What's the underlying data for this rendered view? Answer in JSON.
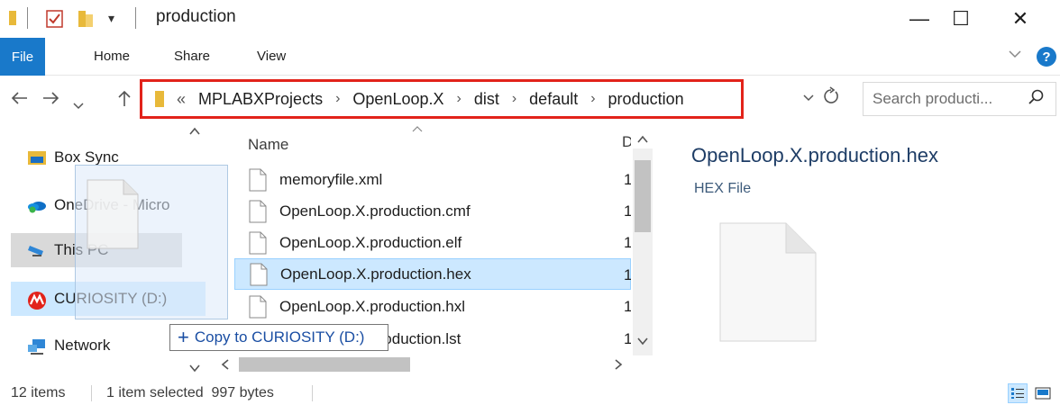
{
  "window": {
    "title": "production",
    "minimize": "—",
    "maximize": "☐",
    "close": "✕"
  },
  "ribbon": {
    "file": "File",
    "tabs": [
      "Home",
      "Share",
      "View"
    ],
    "help": "?"
  },
  "address": {
    "overflow": "«",
    "crumbs": [
      "MPLABXProjects",
      "OpenLoop.X",
      "dist",
      "default",
      "production"
    ]
  },
  "search": {
    "placeholder": "Search producti..."
  },
  "nav_pane": {
    "items": [
      {
        "label": "Box Sync",
        "icon": "box-sync-icon"
      },
      {
        "label": "OneDrive - Micro",
        "icon": "onedrive-icon"
      },
      {
        "label": "This PC",
        "icon": "this-pc-icon"
      },
      {
        "label": "CURIOSITY (D:)",
        "icon": "drive-icon"
      },
      {
        "label": "Network",
        "icon": "network-icon"
      }
    ]
  },
  "file_list": {
    "column_name": "Name",
    "column_date_clip": "D",
    "files": [
      {
        "name": "memoryfile.xml",
        "date_clip": "1"
      },
      {
        "name": "OpenLoop.X.production.cmf",
        "date_clip": "1"
      },
      {
        "name": "OpenLoop.X.production.elf",
        "date_clip": "1"
      },
      {
        "name": "OpenLoop.X.production.hex",
        "date_clip": "1",
        "selected": true
      },
      {
        "name": "OpenLoop.X.production.hxl",
        "date_clip": "1"
      },
      {
        "name": "OpenLoop.X.production.lst",
        "date_clip": "1"
      }
    ]
  },
  "drag_tooltip": {
    "plus": "+",
    "text": "Copy to CURIOSITY (D:)"
  },
  "preview": {
    "filename": "OpenLoop.X.production.hex",
    "filetype": "HEX File"
  },
  "status": {
    "item_count": "12 items",
    "selection": "1 item selected  997 bytes"
  },
  "colors": {
    "accent": "#1979ca",
    "highlight_border": "#e2231a",
    "selection": "#cce8ff"
  }
}
